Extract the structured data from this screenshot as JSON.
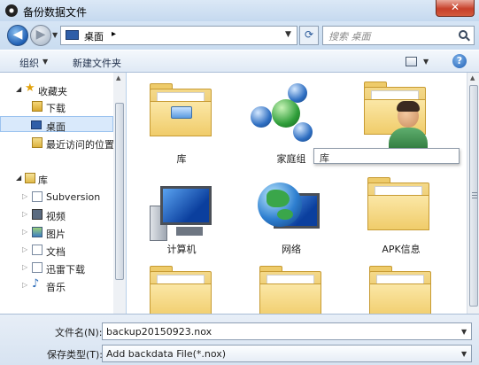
{
  "window": {
    "title": "备份数据文件",
    "close": "✕"
  },
  "address": {
    "path": "桌面",
    "separator": "▸",
    "search_placeholder": "搜索 桌面"
  },
  "toolbar": {
    "organize": "组织",
    "new_folder": "新建文件夹",
    "help": "?"
  },
  "nav": {
    "items": [
      {
        "label": "收藏夹",
        "icon": "star-icon"
      },
      {
        "label": "下载",
        "icon": "download-folder-icon"
      },
      {
        "label": "桌面",
        "icon": "desktop-icon",
        "selected": true
      },
      {
        "label": "最近访问的位置",
        "icon": "recent-places-icon"
      },
      {
        "label": "库",
        "icon": "library-icon"
      },
      {
        "label": "Subversion",
        "icon": "document-library-icon"
      },
      {
        "label": "视频",
        "icon": "video-library-icon"
      },
      {
        "label": "图片",
        "icon": "picture-library-icon"
      },
      {
        "label": "文档",
        "icon": "document-library-icon"
      },
      {
        "label": "迅雷下载",
        "icon": "thunder-download-icon"
      },
      {
        "label": "音乐",
        "icon": "music-library-icon"
      }
    ]
  },
  "content": {
    "items": [
      {
        "label": "库",
        "icon": "library-folder-icon"
      },
      {
        "label": "家庭组",
        "icon": "homegroup-icon"
      },
      {
        "label": "",
        "icon": "user-folder-icon"
      },
      {
        "label": "计算机",
        "icon": "computer-icon"
      },
      {
        "label": "网络",
        "icon": "network-icon"
      },
      {
        "label": "APK信息",
        "icon": "folder-icon"
      },
      {
        "label": "",
        "icon": "folder-icon"
      },
      {
        "label": "",
        "icon": "folder-icon"
      },
      {
        "label": "",
        "icon": "folder-icon"
      }
    ],
    "tooltip": "库"
  },
  "bottom": {
    "filename_label": "文件名(N):",
    "filename_value": "backup20150923.nox",
    "filetype_label": "保存类型(T):",
    "filetype_value": "Add backdata File(*.nox)"
  }
}
